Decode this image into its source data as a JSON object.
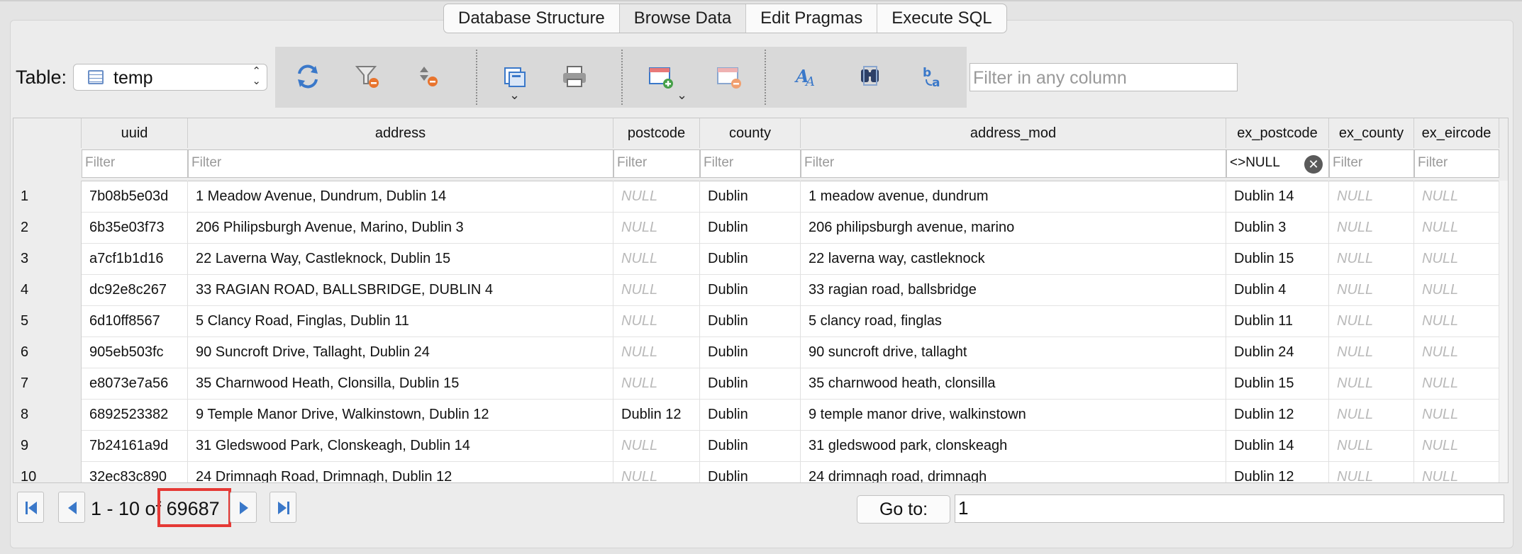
{
  "tabs": [
    "Database Structure",
    "Browse Data",
    "Edit Pragmas",
    "Execute SQL"
  ],
  "selected_tab": "Browse Data",
  "table_label": "Table:",
  "table_name": "temp",
  "filter_any_placeholder": "Filter in any column",
  "toolbar_icons": [
    "refresh-icon",
    "clear-filters-icon",
    "clear-sort-icon",
    "save-table-icon",
    "print-icon",
    "insert-record-icon",
    "delete-record-icon",
    "set-font-icon",
    "find-icon",
    "find-replace-icon"
  ],
  "columns": [
    {
      "name": "uuid",
      "filter": "Filter"
    },
    {
      "name": "address",
      "filter": "Filter"
    },
    {
      "name": "postcode",
      "filter": "Filter"
    },
    {
      "name": "county",
      "filter": "Filter"
    },
    {
      "name": "address_mod",
      "filter": "Filter"
    },
    {
      "name": "ex_postcode",
      "filter": "<>NULL"
    },
    {
      "name": "ex_county",
      "filter": "Filter"
    },
    {
      "name": "ex_eircode",
      "filter": "Filter"
    }
  ],
  "rows": [
    {
      "num": "1",
      "cells": [
        "7b08b5e03d",
        "1 Meadow Avenue, Dundrum, Dublin 14",
        "NULL",
        "Dublin",
        "1 meadow avenue, dundrum",
        "Dublin 14",
        "NULL",
        "NULL"
      ]
    },
    {
      "num": "2",
      "cells": [
        "6b35e03f73",
        "206 Philipsburgh Avenue, Marino, Dublin 3",
        "NULL",
        "Dublin",
        "206 philipsburgh avenue, marino",
        "Dublin 3",
        "NULL",
        "NULL"
      ]
    },
    {
      "num": "3",
      "cells": [
        "a7cf1b1d16",
        "22 Laverna Way, Castleknock, Dublin 15",
        "NULL",
        "Dublin",
        "22 laverna way, castleknock",
        "Dublin 15",
        "NULL",
        "NULL"
      ]
    },
    {
      "num": "4",
      "cells": [
        "dc92e8c267",
        "33 RAGIAN ROAD, BALLSBRIDGE, DUBLIN 4",
        "NULL",
        "Dublin",
        "33 ragian road, ballsbridge",
        "Dublin 4",
        "NULL",
        "NULL"
      ]
    },
    {
      "num": "5",
      "cells": [
        "6d10ff8567",
        "5 Clancy Road, Finglas, Dublin 11",
        "NULL",
        "Dublin",
        "5 clancy road, finglas",
        "Dublin 11",
        "NULL",
        "NULL"
      ]
    },
    {
      "num": "6",
      "cells": [
        "905eb503fc",
        "90 Suncroft Drive, Tallaght, Dublin 24",
        "NULL",
        "Dublin",
        "90 suncroft drive, tallaght",
        "Dublin 24",
        "NULL",
        "NULL"
      ]
    },
    {
      "num": "7",
      "cells": [
        "e8073e7a56",
        "35 Charnwood Heath, Clonsilla, Dublin 15",
        "NULL",
        "Dublin",
        "35 charnwood heath, clonsilla",
        "Dublin 15",
        "NULL",
        "NULL"
      ]
    },
    {
      "num": "8",
      "cells": [
        "6892523382",
        "9 Temple Manor Drive, Walkinstown, Dublin 12",
        "Dublin 12",
        "Dublin",
        "9 temple manor drive, walkinstown",
        "Dublin 12",
        "NULL",
        "NULL"
      ]
    },
    {
      "num": "9",
      "cells": [
        "7b24161a9d",
        "31 Gledswood Park, Clonskeagh, Dublin 14",
        "NULL",
        "Dublin",
        "31 gledswood park, clonskeagh",
        "Dublin 14",
        "NULL",
        "NULL"
      ]
    },
    {
      "num": "10",
      "cells": [
        "32ec83c890",
        "24 Drimnagh Road, Drimnagh, Dublin 12",
        "NULL",
        "Dublin",
        "24 drimnagh road, drimnagh",
        "Dublin 12",
        "NULL",
        "NULL"
      ]
    }
  ],
  "pager": {
    "range": "1 - 10 of",
    "total": "69687"
  },
  "goto_label": "Go to:",
  "goto_value": "1",
  "colors": {
    "accent_icon": "#3a78c9",
    "highlight": "#e53935",
    "null_text": "#b9b9b9"
  }
}
